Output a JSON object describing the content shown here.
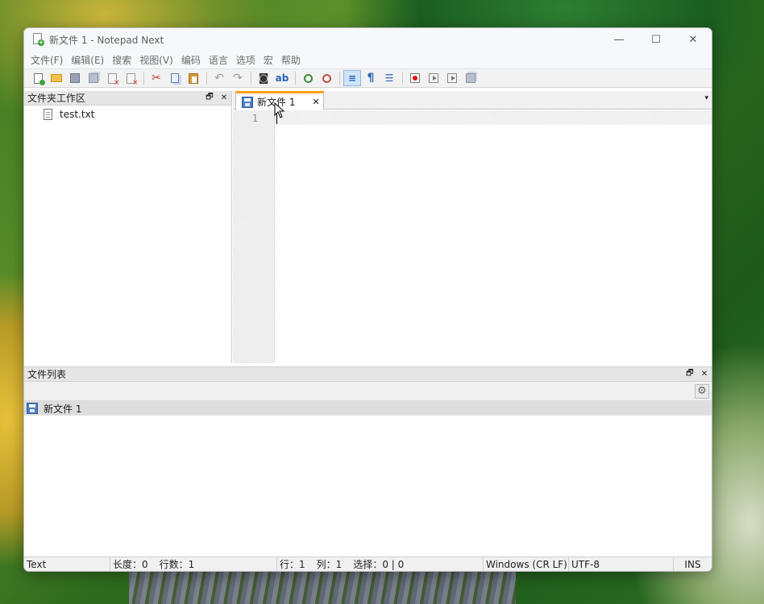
{
  "window": {
    "title": "新文件 1 - Notepad Next"
  },
  "window_controls": {
    "minimize": "—",
    "maximize": "☐",
    "close": "✕"
  },
  "menu": [
    "文件(F)",
    "编辑(E)",
    "搜索",
    "视图(V)",
    "编码",
    "语言",
    "选项",
    "宏",
    "帮助"
  ],
  "toolbar": {
    "buttons": [
      "new-file",
      "open-file",
      "save",
      "save-all",
      "close",
      "close-all",
      "cut",
      "copy",
      "paste",
      "undo",
      "redo",
      "find",
      "replace",
      "zoom-in",
      "zoom-out",
      "word-wrap",
      "show-all-characters",
      "indent-guide",
      "record-macro",
      "play-macro",
      "run-macro-multiple",
      "save-macro"
    ],
    "active": "word-wrap"
  },
  "folder_workspace": {
    "title": "文件夹工作区",
    "float_glyph": "🗗",
    "close_glyph": "✕",
    "files": [
      "test.txt"
    ]
  },
  "editor": {
    "tab": {
      "label": "新文件 1",
      "close_glyph": "✕"
    },
    "dropdown_glyph": "▾",
    "line_numbers": [
      "1"
    ],
    "content": ""
  },
  "file_list": {
    "title": "文件列表",
    "float_glyph": "🗗",
    "close_glyph": "✕",
    "items": [
      "新文件 1"
    ]
  },
  "statusbar": {
    "language": "Text",
    "length_label": "长度：",
    "length_value": "0",
    "lines_label": "行数：",
    "lines_value": "1",
    "row_label": "行：",
    "row_value": "1",
    "col_label": "列：",
    "col_value": "1",
    "selection_label": "选择：",
    "selection_value": "0 | 0",
    "eol": "Windows (CR LF)",
    "encoding": "UTF-8",
    "mode": "INS"
  },
  "colors": {
    "tab_accent": "#ff9c1f",
    "active_button": "#cde4f7",
    "panel_header": "#e6e6e6"
  }
}
